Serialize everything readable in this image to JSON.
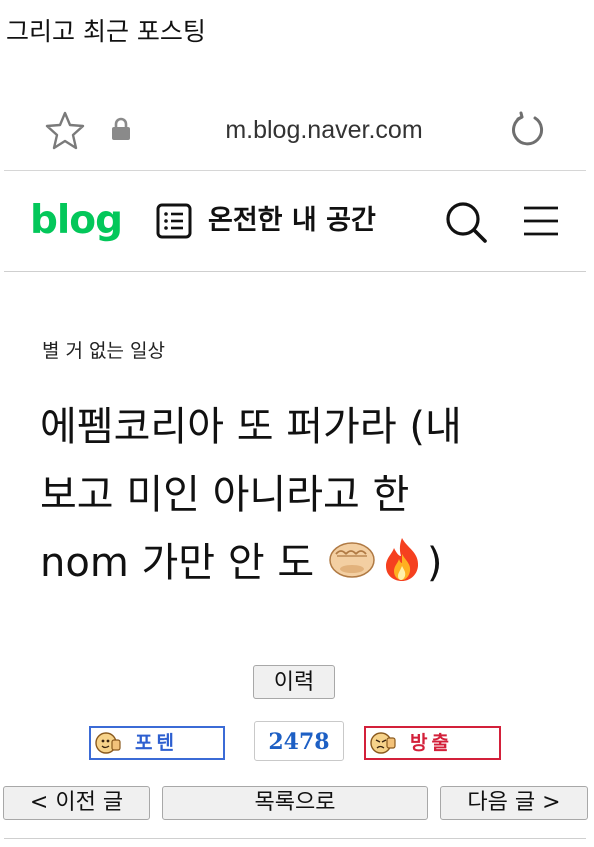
{
  "caption": "그리고 최근 포스팅",
  "browser": {
    "url": "m.blog.naver.com",
    "icons": [
      "star-icon",
      "lock-icon",
      "reload-icon"
    ]
  },
  "header": {
    "logo": "blog",
    "blog_name": "온전한 내 공간",
    "icons": [
      "list-icon",
      "search-icon",
      "menu-icon"
    ]
  },
  "post": {
    "category": "별 거 없는 일상",
    "title_lines": [
      "에펨코리아 또 퍼가라 (내",
      "보고 미인 아니라고 한",
      "nom 가만 안 도"
    ],
    "title_suffix": ")",
    "title_emojis": [
      "oncoming-fist-emoji",
      "fire-emoji"
    ]
  },
  "actions": {
    "history_label": "이력",
    "poten_label": "포텐",
    "view_count": "2478",
    "bangchul_label": "방출"
  },
  "nav": {
    "prev_label": "< 이전 글",
    "list_label": "목록으로",
    "next_label": "다음 글 >"
  },
  "colors": {
    "brand_green": "#03c75a",
    "poten_blue": "#2d5fd0",
    "bangchul_red": "#d3203a"
  }
}
